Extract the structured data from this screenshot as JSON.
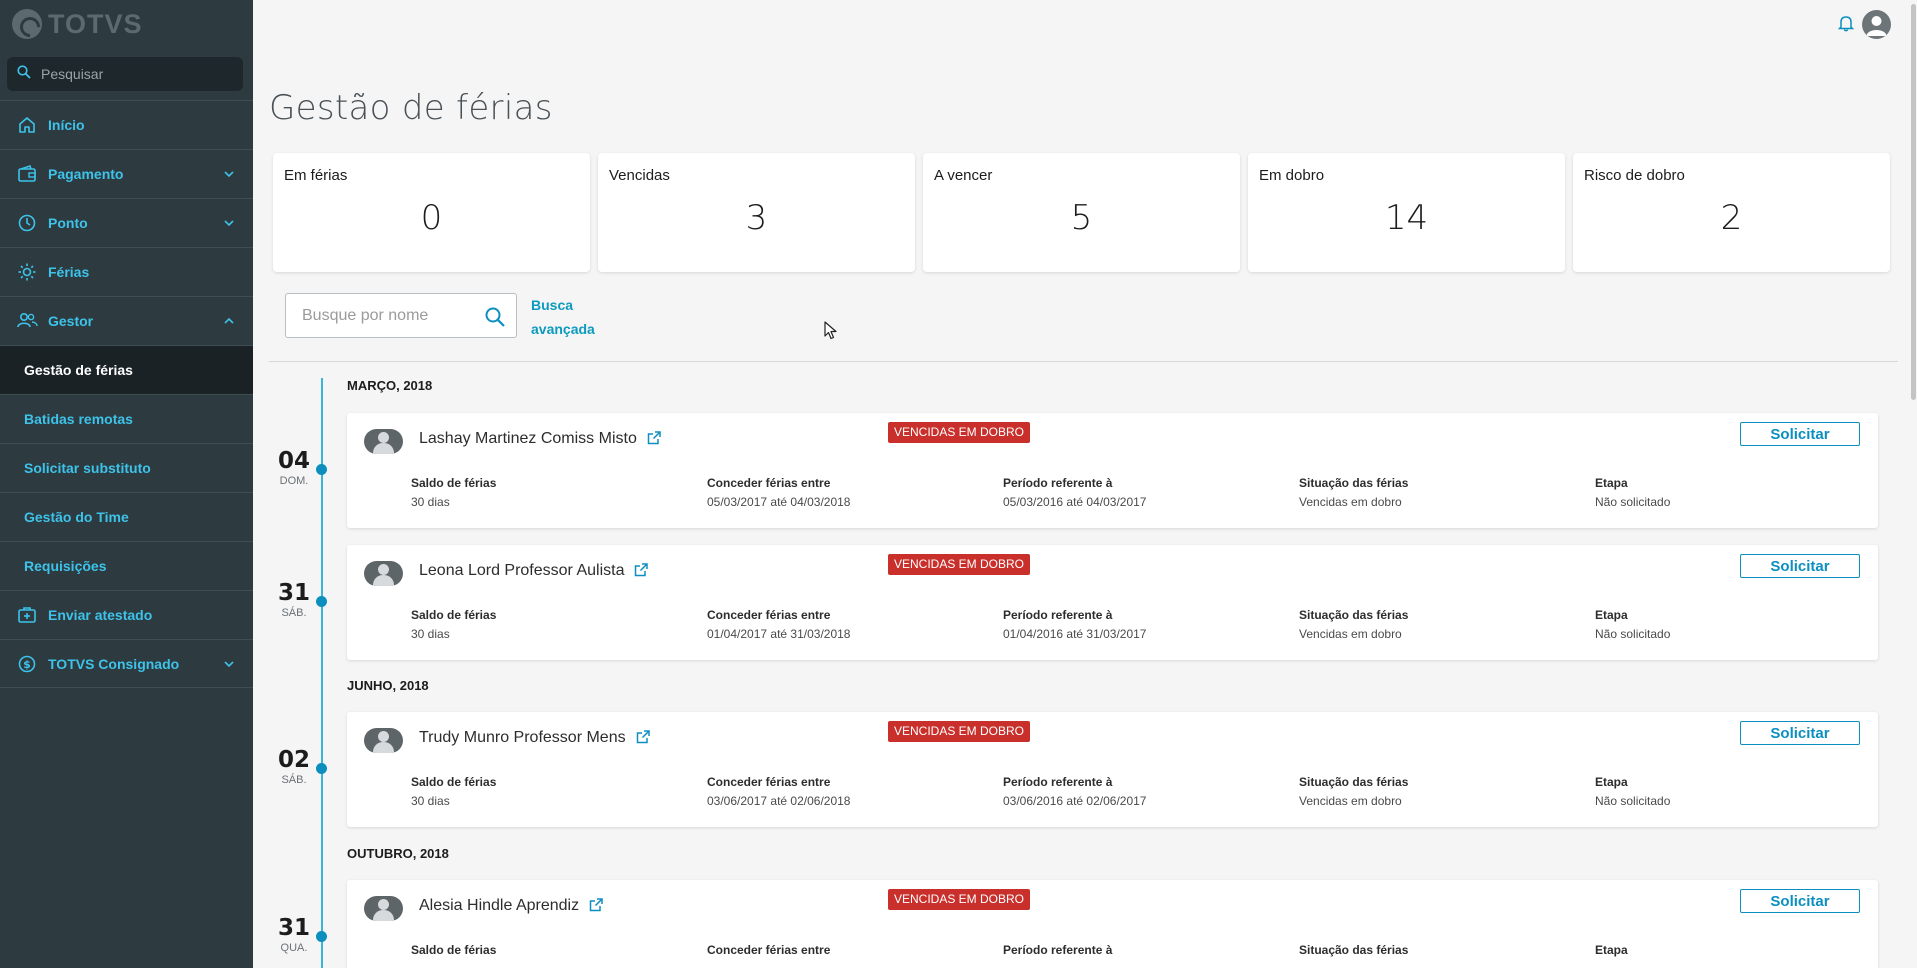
{
  "app": {
    "logo_text": "TOTVS"
  },
  "sidebar": {
    "search_placeholder": "Pesquisar",
    "items": [
      {
        "label": "Início",
        "icon": "home-icon",
        "has_chevron": false
      },
      {
        "label": "Pagamento",
        "icon": "wallet-icon",
        "has_chevron": true
      },
      {
        "label": "Ponto",
        "icon": "clock-icon",
        "has_chevron": true
      },
      {
        "label": "Férias",
        "icon": "sun-icon",
        "has_chevron": false
      },
      {
        "label": "Gestor",
        "icon": "team-icon",
        "has_chevron": true,
        "expanded": true
      }
    ],
    "sub_items": [
      {
        "label": "Gestão de férias",
        "active": true
      },
      {
        "label": "Batidas remotas"
      },
      {
        "label": "Solicitar substituto"
      },
      {
        "label": "Gestão do Time"
      },
      {
        "label": "Requisições"
      }
    ],
    "bottom_items": [
      {
        "label": "Enviar atestado",
        "icon": "medical-kit-icon",
        "has_chevron": false
      },
      {
        "label": "TOTVS Consignado",
        "icon": "dollar-circle-icon",
        "has_chevron": true
      }
    ],
    "accent_color": "#3dc3e9"
  },
  "page": {
    "title": "Gestão de férias"
  },
  "stats": [
    {
      "label": "Em férias",
      "value": "0"
    },
    {
      "label": "Vencidas",
      "value": "3"
    },
    {
      "label": "A vencer",
      "value": "5"
    },
    {
      "label": "Em dobro",
      "value": "14"
    },
    {
      "label": "Risco de dobro",
      "value": "2"
    }
  ],
  "search": {
    "placeholder": "Busque por nome",
    "advanced_line1": "Busca",
    "advanced_line2": "avançada"
  },
  "field_labels": {
    "saldo": "Saldo de férias",
    "conceder": "Conceder férias entre",
    "periodo": "Período referente à",
    "situacao": "Situação das férias",
    "etapa": "Etapa"
  },
  "months": [
    "MARÇO, 2018",
    "JUNHO, 2018",
    "OUTUBRO, 2018"
  ],
  "entries": [
    {
      "day": "04",
      "weekday": "DOM.",
      "name": "Lashay Martinez Comiss Misto",
      "badge": "VENCIDAS EM DOBRO",
      "action": "Solicitar",
      "saldo": "30 dias",
      "conceder": "05/03/2017 até 04/03/2018",
      "periodo": "05/03/2016 até 04/03/2017",
      "situacao": "Vencidas em dobro",
      "etapa": "Não solicitado"
    },
    {
      "day": "31",
      "weekday": "SÁB.",
      "name": "Leona Lord Professor Aulista",
      "badge": "VENCIDAS EM DOBRO",
      "action": "Solicitar",
      "saldo": "30 dias",
      "conceder": "01/04/2017 até 31/03/2018",
      "periodo": "01/04/2016 até 31/03/2017",
      "situacao": "Vencidas em dobro",
      "etapa": "Não solicitado"
    },
    {
      "day": "02",
      "weekday": "SÁB.",
      "name": "Trudy Munro Professor Mens",
      "badge": "VENCIDAS EM DOBRO",
      "action": "Solicitar",
      "saldo": "30 dias",
      "conceder": "03/06/2017 até 02/06/2018",
      "periodo": "03/06/2016 até 02/06/2017",
      "situacao": "Vencidas em dobro",
      "etapa": "Não solicitado"
    },
    {
      "day": "31",
      "weekday": "QUA.",
      "name": "Alesia Hindle Aprendiz",
      "badge": "VENCIDAS EM DOBRO",
      "action": "Solicitar",
      "saldo": "",
      "conceder": "",
      "periodo": "",
      "situacao": "",
      "etapa": ""
    }
  ],
  "colors": {
    "badge": "#c9302c",
    "primary": "#0c8fbf",
    "sidebar_bg": "#2d3a40"
  }
}
